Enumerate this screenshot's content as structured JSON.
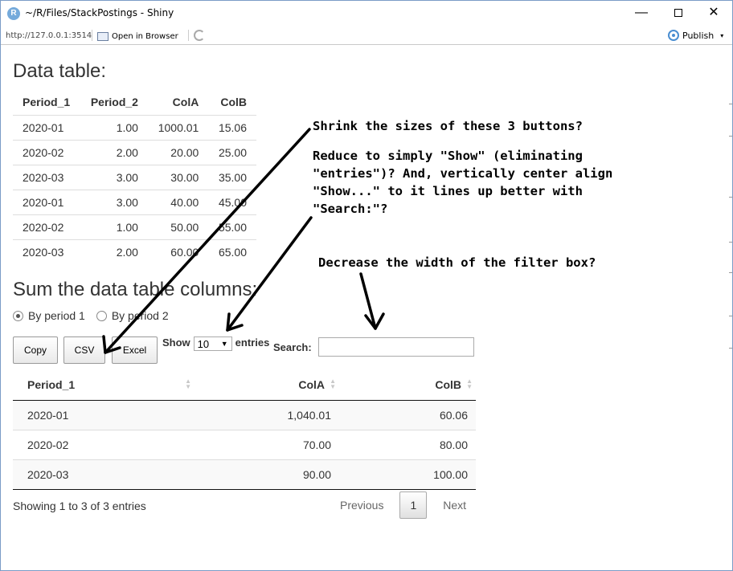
{
  "window": {
    "title": "~/R/Files/StackPostings - Shiny",
    "app_icon": "R",
    "minimize": "—",
    "close": "✕"
  },
  "addressbar": {
    "url": "http://127.0.0.1:3514",
    "open_in_browser": "Open in Browser",
    "publish": "Publish",
    "publish_caret": "▾"
  },
  "data_table": {
    "heading": "Data table:",
    "columns": [
      "Period_1",
      "Period_2",
      "ColA",
      "ColB"
    ],
    "rows": [
      [
        "2020-01",
        "1.00",
        "1000.01",
        "15.06"
      ],
      [
        "2020-02",
        "2.00",
        "20.00",
        "25.00"
      ],
      [
        "2020-03",
        "3.00",
        "30.00",
        "35.00"
      ],
      [
        "2020-01",
        "3.00",
        "40.00",
        "45.00"
      ],
      [
        "2020-02",
        "1.00",
        "50.00",
        "55.00"
      ],
      [
        "2020-03",
        "2.00",
        "60.00",
        "65.00"
      ]
    ]
  },
  "sum_section": {
    "heading": "Sum the data table columns:",
    "radio_options": [
      {
        "label": "By period 1",
        "checked": true
      },
      {
        "label": "By period 2",
        "checked": false
      }
    ],
    "buttons": {
      "copy": "Copy",
      "csv": "CSV",
      "excel": "Excel"
    },
    "length": {
      "prefix": "Show",
      "value": "10",
      "suffix": "entries",
      "arrow": "▼"
    },
    "search": {
      "label": "Search:",
      "value": "",
      "placeholder": ""
    },
    "columns": [
      "Period_1",
      "ColA",
      "ColB"
    ],
    "sort_icon": "▲▼",
    "rows": [
      [
        "2020-01",
        "1,040.01",
        "60.06"
      ],
      [
        "2020-02",
        "70.00",
        "80.00"
      ],
      [
        "2020-03",
        "90.00",
        "100.00"
      ]
    ],
    "info": "Showing 1 to 3 of 3 entries",
    "pagination": {
      "previous": "Previous",
      "current": "1",
      "next": "Next"
    }
  },
  "annotations": {
    "shrink": "Shrink the sizes of these 3 buttons?",
    "reduce": "Reduce to simply \"Show\" (eliminating\n\"entries\")? And, vertically center align\n\"Show...\" to it lines up better with\n\"Search:\"?",
    "decrease": "Decrease the width of the filter box?"
  }
}
